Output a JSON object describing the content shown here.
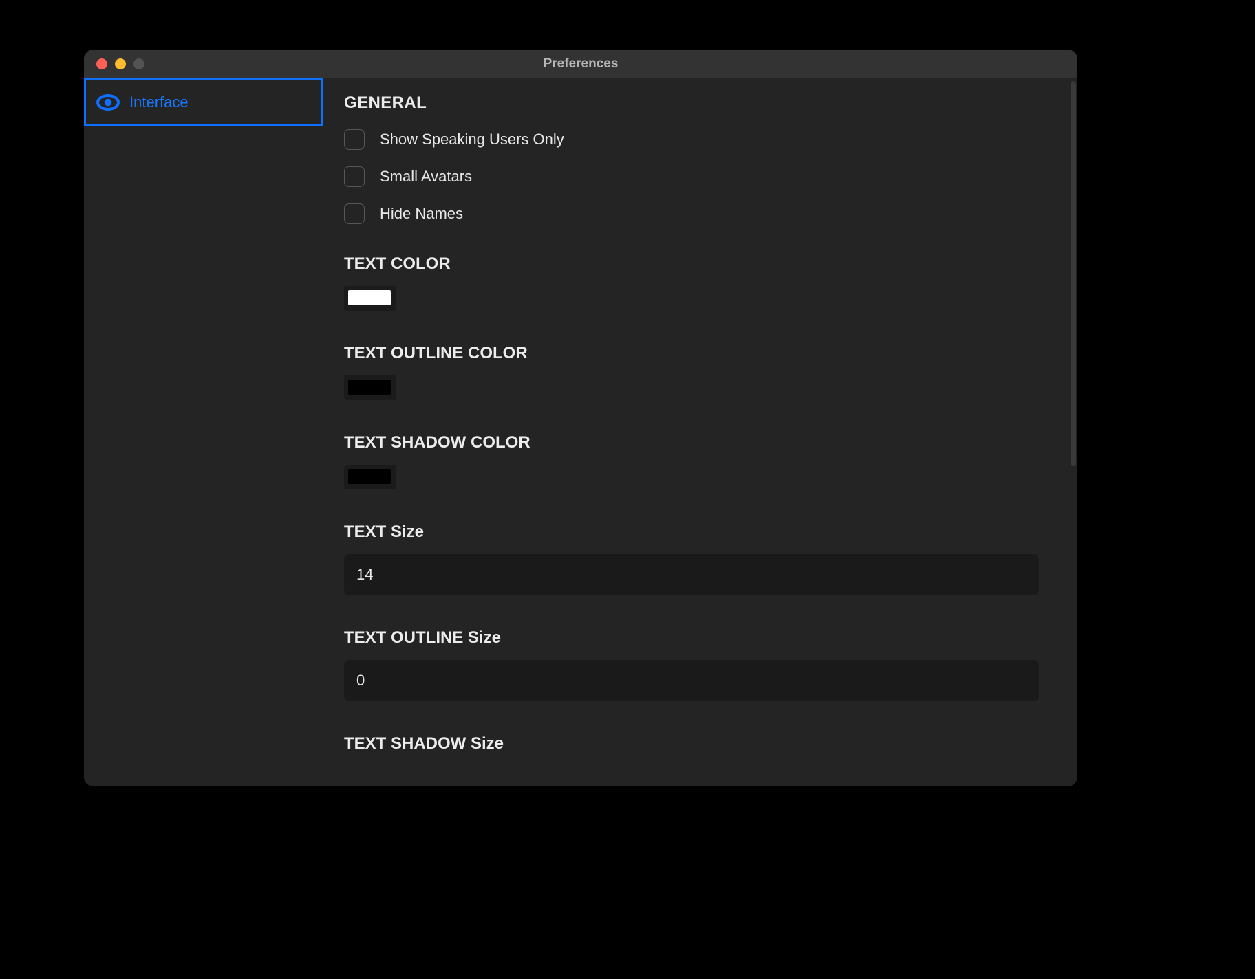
{
  "window": {
    "title": "Preferences"
  },
  "sidebar": {
    "items": [
      {
        "label": "Interface",
        "icon": "eye-icon",
        "selected": true
      }
    ]
  },
  "sections": {
    "general": {
      "title": "GENERAL",
      "options": [
        {
          "label": "Show Speaking Users Only",
          "checked": false
        },
        {
          "label": "Small Avatars",
          "checked": false
        },
        {
          "label": "Hide Names",
          "checked": false
        }
      ]
    },
    "text_color": {
      "title": "TEXT COLOR",
      "value": "#ffffff"
    },
    "text_outline_color": {
      "title": "TEXT OUTLINE COLOR",
      "value": "#000000"
    },
    "text_shadow_color": {
      "title": "TEXT SHADOW COLOR",
      "value": "#000000"
    },
    "text_size": {
      "title": "TEXT Size",
      "value": "14"
    },
    "text_outline_size": {
      "title": "TEXT OUTLINE Size",
      "value": "0"
    },
    "text_shadow_size": {
      "title": "TEXT SHADOW Size"
    }
  }
}
